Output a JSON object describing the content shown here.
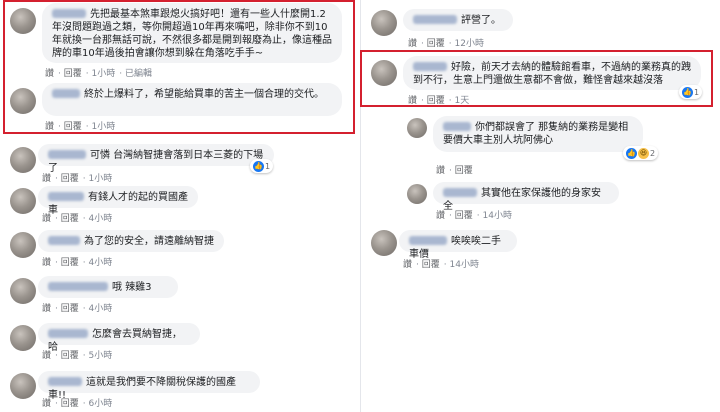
{
  "actions": {
    "like": "讚",
    "reply": "回覆",
    "edited": "已編輯"
  },
  "left": [
    {
      "text": "先把最基本煞車跟熄火搞好吧！還有一些人什麼開1.2年沒問題跑過之類，等你開超過10年再來嘴吧，除非你不到10年就換一台那無話可說，不然很多都是開到報廢為止，像這種品牌的車10年過後拍會讓你想到躲在角落吃手手~",
      "time": "1小時",
      "edited": true
    },
    {
      "text": "終於上爆料了，希望能給買車的苦主一個合理的交代。",
      "time": "1小時"
    },
    {
      "text": "可憐 台灣納智捷會落到日本三菱的下場了",
      "time": "1小時",
      "reactions": "1"
    },
    {
      "text": "有錢人才的起的買國產車",
      "time": "4小時"
    },
    {
      "text": "為了您的安全，請遠離納智捷",
      "time": "4小時"
    },
    {
      "text": "哦 辣雞3",
      "time": "4小時"
    },
    {
      "text": "怎麼會去買納智捷，哈",
      "time": "5小時"
    },
    {
      "text": "這就是我們要不降關稅保護的國產車!!",
      "time": "6小時"
    }
  ],
  "right": [
    {
      "text": "評營了。",
      "time": "12小時"
    },
    {
      "text": "好險，前天才去納的體驗館看車，不過納的業務真的跩到不行，生意上門還做生意都不會做，難怪會越來越沒落",
      "time": "1天",
      "reactions": "1"
    },
    {
      "text": "你們都誤會了 那隻納的業務是變相要價大車主別人坑阿佛心",
      "time": "",
      "reactions": "2"
    },
    {
      "text": "其實他在家保護他的身家安全",
      "time": "14小時"
    },
    {
      "text": "唉唉唉二手車價",
      "time": "14小時"
    }
  ],
  "colors": {
    "highlight": "#d4202f",
    "bubble": "#f2f3f5",
    "like": "#1877f2"
  }
}
